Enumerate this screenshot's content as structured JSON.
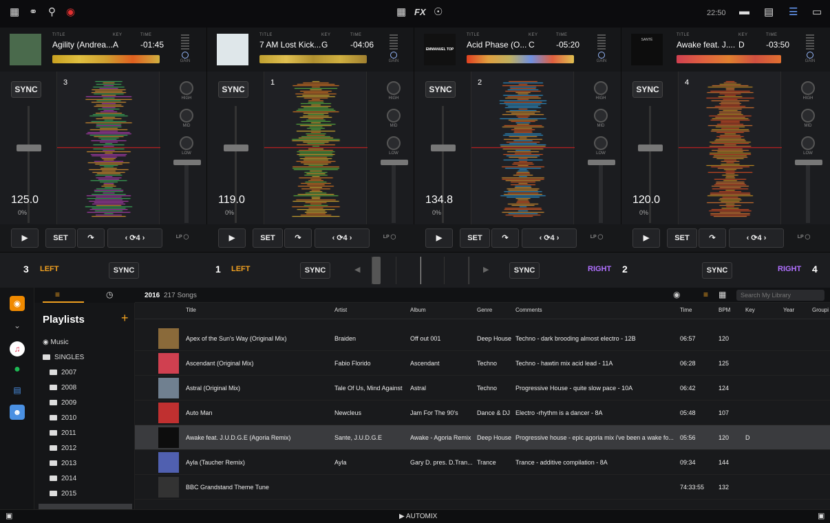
{
  "topbar": {
    "clock": "22:50",
    "fx_label": "FX"
  },
  "decks_info": [
    {
      "title_label": "TITLE",
      "key_label": "KEY",
      "time_label": "TIME",
      "gain_label": "GAIN",
      "title": "Agility (Andrea...",
      "key": "A",
      "time": "-01:45",
      "art_color": "#4a6a4c"
    },
    {
      "title_label": "TITLE",
      "key_label": "KEY",
      "time_label": "TIME",
      "gain_label": "GAIN",
      "title": "7 AM Lost Kick...",
      "key": "G",
      "time": "-04:06",
      "art_color": "#dfe7ea"
    },
    {
      "title_label": "TITLE",
      "key_label": "KEY",
      "time_label": "TIME",
      "gain_label": "GAIN",
      "title": "Acid Phase (O...",
      "key": "C",
      "time": "-05:20",
      "art_color": "#111111",
      "art_text": "EMMANUEL TOP"
    },
    {
      "title_label": "TITLE",
      "key_label": "KEY",
      "time_label": "TIME",
      "gain_label": "GAIN",
      "title": "Awake feat. J....",
      "key": "D",
      "time": "-03:50",
      "art_color": "#0d0d0d",
      "art_text": "SANTÉ"
    }
  ],
  "decks": [
    {
      "sync": "SYNC",
      "number": "3",
      "bpm": "125.0",
      "pct": "0%",
      "eq": [
        "HIGH",
        "MID",
        "LOW"
      ],
      "wave_colors": [
        "#f0a030",
        "#40c060",
        "#c040c0"
      ]
    },
    {
      "sync": "SYNC",
      "number": "1",
      "bpm": "119.0",
      "pct": "0%",
      "eq": [
        "HIGH",
        "MID",
        "LOW"
      ],
      "wave_colors": [
        "#f08020",
        "#f0c030",
        "#60c040"
      ]
    },
    {
      "sync": "SYNC",
      "number": "2",
      "bpm": "134.8",
      "pct": "0%",
      "eq": [
        "HIGH",
        "MID",
        "LOW"
      ],
      "wave_colors": [
        "#f06020",
        "#f0a030",
        "#30a0e0"
      ]
    },
    {
      "sync": "SYNC",
      "number": "4",
      "bpm": "120.0",
      "pct": "0%",
      "eq": [
        "HIGH",
        "MID",
        "LOW"
      ],
      "wave_colors": [
        "#f05020",
        "#f08030",
        "#e0a020"
      ]
    }
  ],
  "controls": {
    "set": "SET",
    "loop": "4",
    "lp": "LP",
    "hp": "HP"
  },
  "mixer": {
    "deck_left_a": "3",
    "deck_left_b": "1",
    "deck_right_a": "2",
    "deck_right_b": "4",
    "left": "LEFT",
    "right": "RIGHT",
    "sync": "SYNC"
  },
  "playlists": {
    "title": "Playlists",
    "add": "+",
    "music": "Music",
    "singles": "SINGLES",
    "years": [
      "2007",
      "2008",
      "2009",
      "2010",
      "2011",
      "2012",
      "2013",
      "2014",
      "2015"
    ]
  },
  "library": {
    "folder": "2016",
    "count": "217 Songs",
    "search_placeholder": "Search My Library",
    "automix": "AUTOMIX",
    "columns": {
      "title": "Title",
      "artist": "Artist",
      "album": "Album",
      "genre": "Genre",
      "comments": "Comments",
      "time": "Time",
      "bpm": "BPM",
      "key": "Key",
      "year": "Year",
      "grouping": "Groupi"
    },
    "rows": [
      {
        "title": "Apex of the Sun's Way (Original Mix)",
        "artist": "Braiden",
        "album": "Off out 001",
        "genre": "Deep House",
        "comments": "Techno - dark brooding almost electro - 12B",
        "time": "06:57",
        "bpm": "120",
        "key": "",
        "thumb": "#8a6a3a"
      },
      {
        "title": "Ascendant (Original Mix)",
        "artist": "Fabio Florido",
        "album": "Ascendant",
        "genre": "Techno",
        "comments": "Techno - hawtin mix acid lead - 11A",
        "time": "06:28",
        "bpm": "125",
        "key": "",
        "thumb": "#d04050"
      },
      {
        "title": "Astral (Original Mix)",
        "artist": "Tale Of Us, Mind Against",
        "album": "Astral",
        "genre": "Techno",
        "comments": "Progressive House - quite slow pace - 10A",
        "time": "06:42",
        "bpm": "124",
        "key": "",
        "thumb": "#708090"
      },
      {
        "title": "Auto Man",
        "artist": "Newcleus",
        "album": "Jam For The 90's",
        "genre": "Dance & DJ",
        "comments": "Electro -rhythm is a dancer - 8A",
        "time": "05:48",
        "bpm": "107",
        "key": "",
        "thumb": "#c03030"
      },
      {
        "title": "Awake feat. J.U.D.G.E (Agoria Remix)",
        "artist": "Sante, J.U.D.G.E",
        "album": "Awake - Agoria Remix",
        "genre": "Deep House",
        "comments": "Progressive house - epic agoria mix i've been a wake fo...",
        "time": "05:56",
        "bpm": "120",
        "key": "D",
        "thumb": "#0d0d0d",
        "selected": true
      },
      {
        "title": "Ayla (Taucher Remix)",
        "artist": "Ayla",
        "album": "Gary D. pres. D.Tran...",
        "genre": "Trance",
        "comments": "Trance - additive compilation - 8A",
        "time": "09:34",
        "bpm": "144",
        "key": "",
        "thumb": "#5060b0"
      },
      {
        "title": "BBC Grandstand Theme Tune",
        "artist": "",
        "album": "",
        "genre": "",
        "comments": "",
        "time": "74:33:55",
        "bpm": "132",
        "key": "",
        "thumb": "#333333"
      }
    ]
  }
}
